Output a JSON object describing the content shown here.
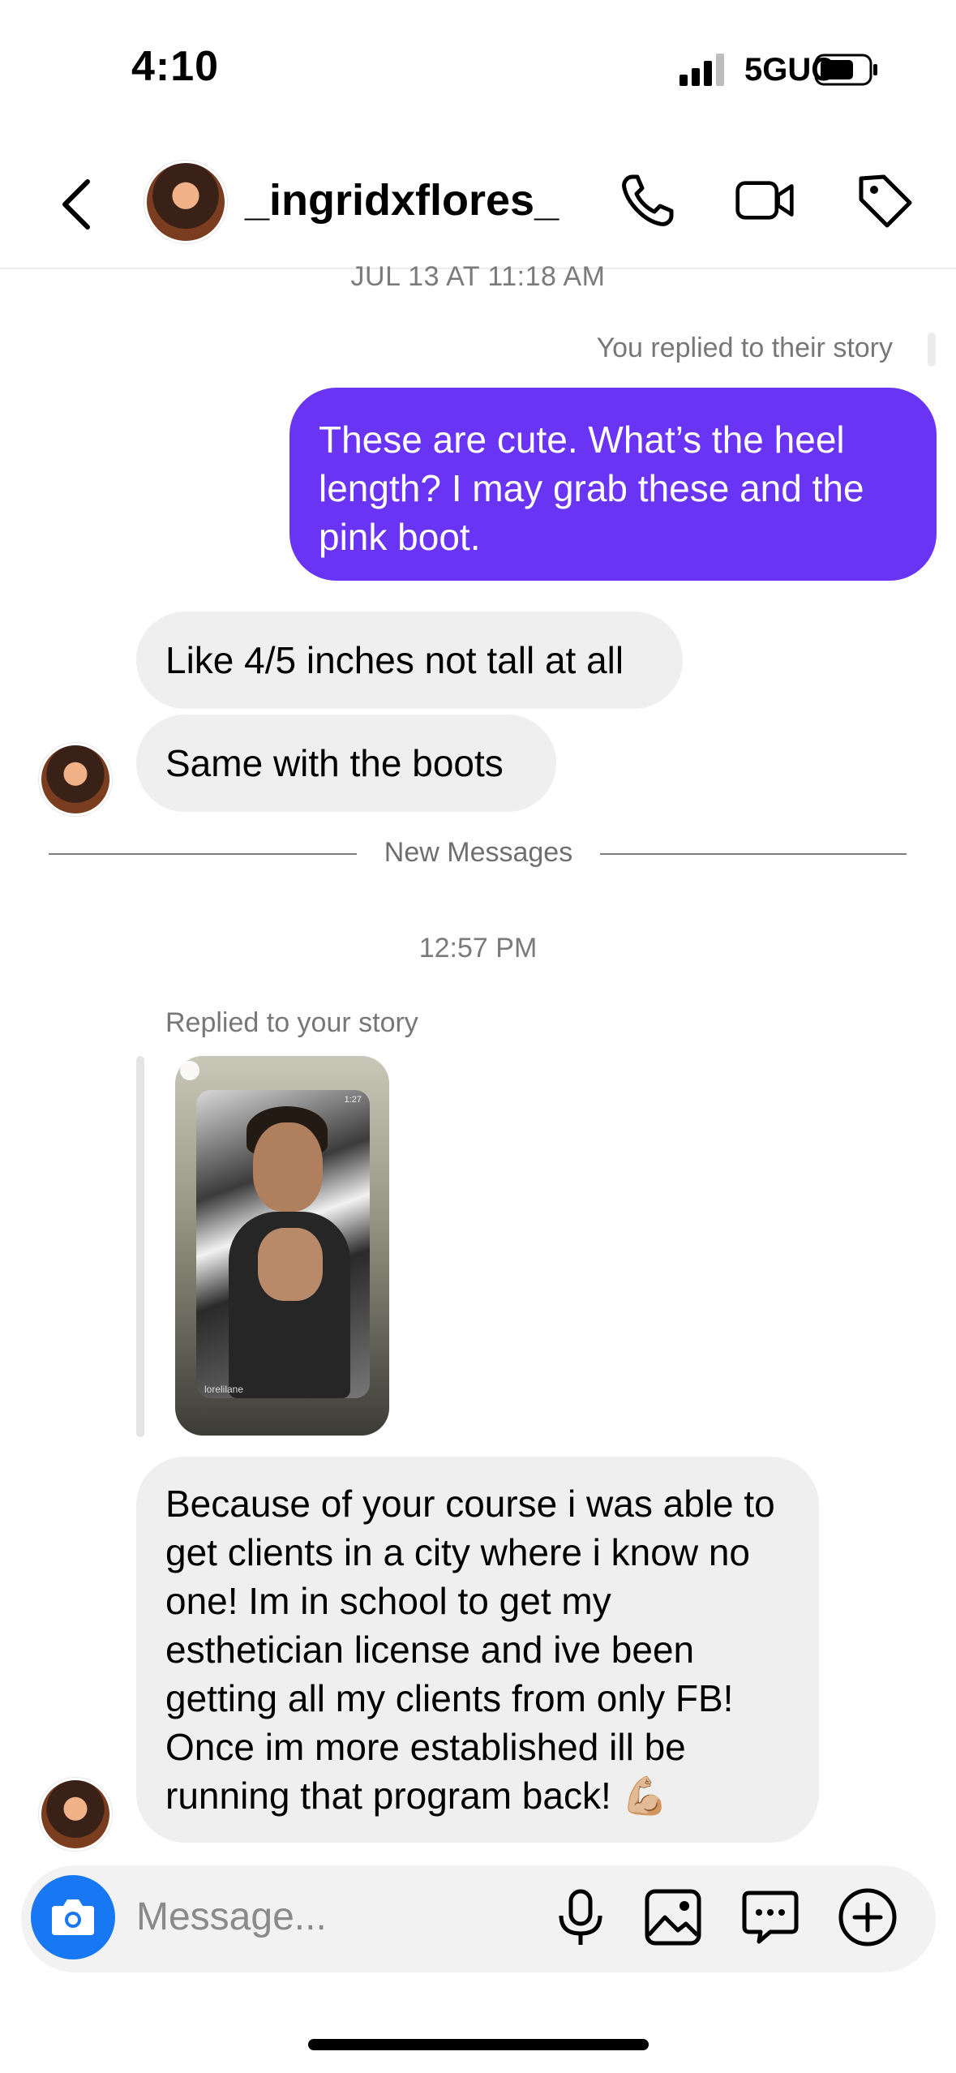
{
  "status_bar": {
    "time": "4:10",
    "network": "5GUC"
  },
  "header": {
    "username": "_ingridxflores_"
  },
  "conversation": {
    "date_label": "JUL 13 AT 11:18 AM",
    "replied_note": "You replied to their story",
    "sent_message": "These are cute. What’s the heel length? I may grab these and the pink boot.",
    "received_1": "Like 4/5 inches not tall at all",
    "received_2": "Same with the boots",
    "new_messages_label": "New Messages",
    "time_label": "12:57 PM",
    "replied_story_label": "Replied to your story",
    "story_username": "lorelilane",
    "story_timer": "1:27",
    "received_3": "Because of your course i was able to get clients in a city where i know no one! Im in school to get my esthetician license and ive been getting all my clients from only FB! Once im more established ill be running that program back! 💪🏼"
  },
  "composer": {
    "placeholder": "Message..."
  },
  "colors": {
    "sent_bubble": "#6a34f5",
    "received_bubble": "#efefef",
    "camera_button": "#1877f2"
  },
  "icons": [
    "back-icon",
    "phone-icon",
    "video-icon",
    "tag-icon",
    "camera-icon",
    "microphone-icon",
    "gallery-icon",
    "sticker-icon",
    "plus-icon"
  ]
}
